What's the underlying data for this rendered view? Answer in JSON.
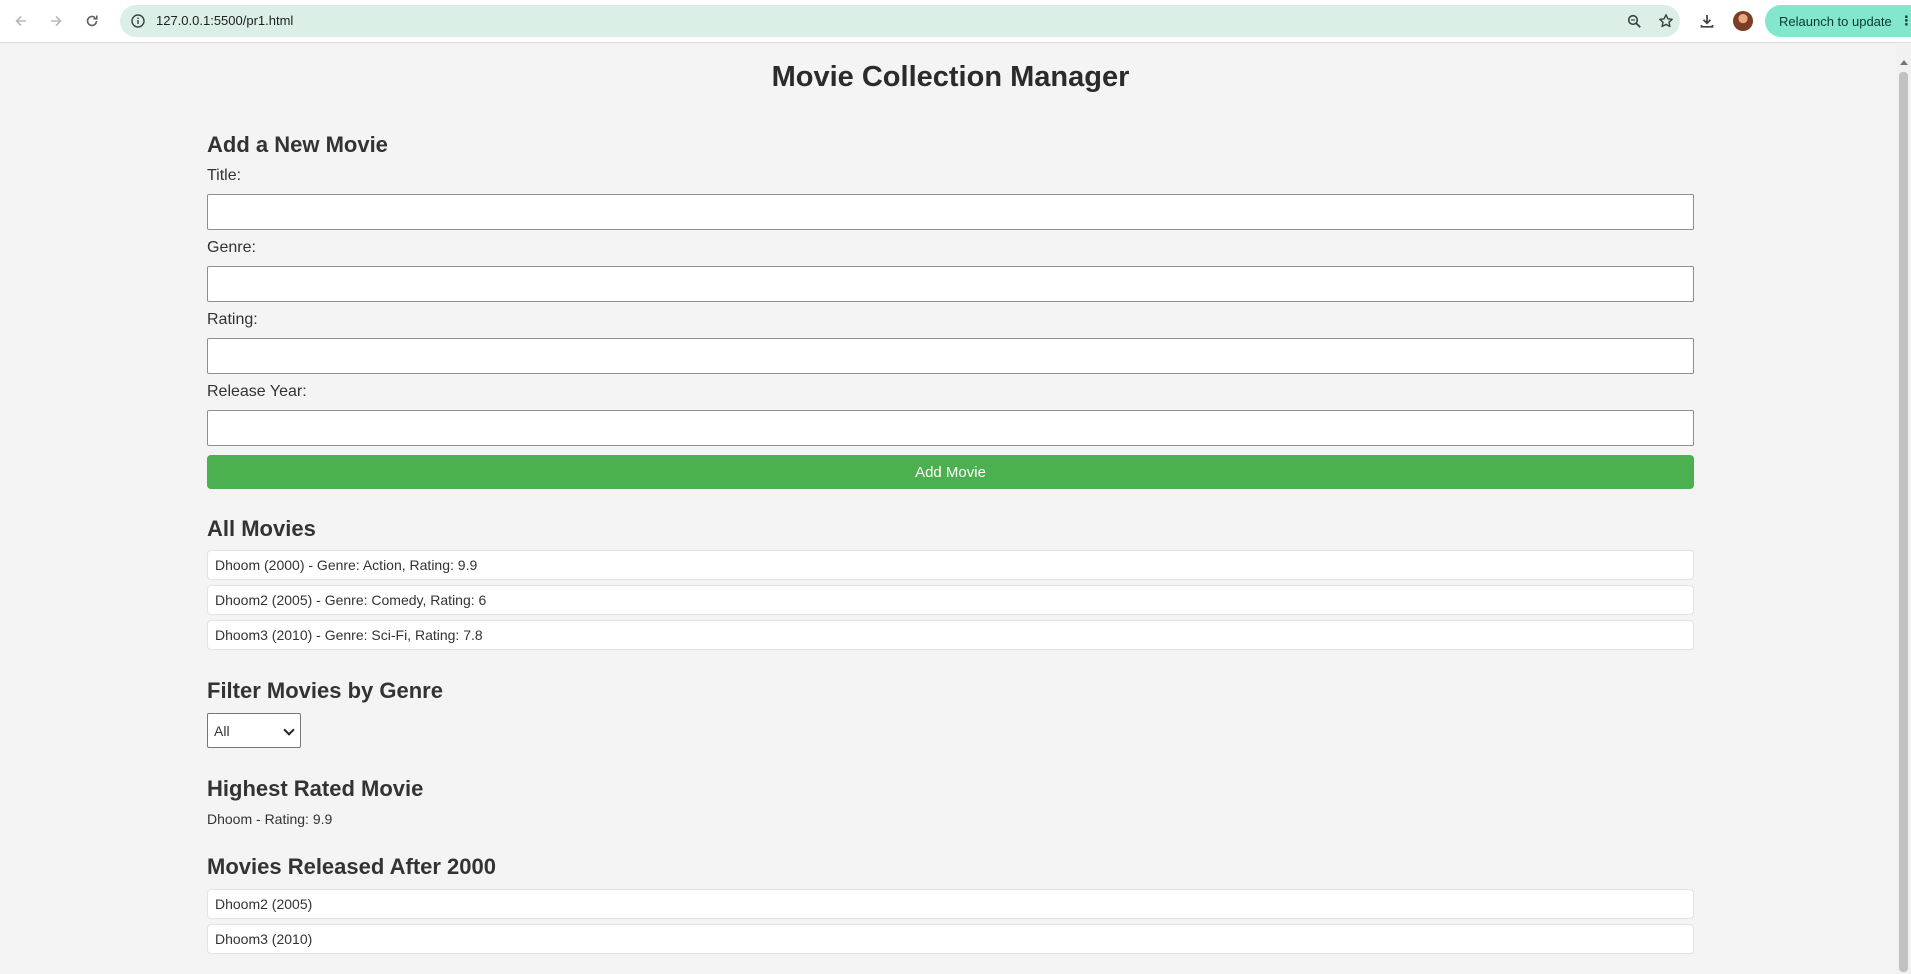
{
  "browser": {
    "url": "127.0.0.1:5500/pr1.html",
    "relaunch_label": "Relaunch to update",
    "icons": [
      "back-icon",
      "forward-icon",
      "reload-icon",
      "site-info-icon",
      "zoom-icon",
      "bookmark-star-icon",
      "download-icon",
      "profile-avatar",
      "menu-kebab-icon"
    ]
  },
  "page": {
    "title": "Movie Collection Manager",
    "add_section": {
      "heading": "Add a New Movie",
      "fields": [
        {
          "label": "Title:",
          "value": ""
        },
        {
          "label": "Genre:",
          "value": ""
        },
        {
          "label": "Rating:",
          "value": ""
        },
        {
          "label": "Release Year:",
          "value": ""
        }
      ],
      "button_label": "Add Movie"
    },
    "all_movies": {
      "heading": "All Movies",
      "items": [
        "Dhoom (2000) - Genre: Action, Rating: 9.9",
        "Dhoom2 (2005) - Genre: Comedy, Rating: 6",
        "Dhoom3 (2010) - Genre: Sci-Fi, Rating: 7.8"
      ]
    },
    "filter": {
      "heading": "Filter Movies by Genre",
      "selected": "All"
    },
    "highest_rated": {
      "heading": "Highest Rated Movie",
      "text": "Dhoom - Rating: 9.9"
    },
    "after_2000": {
      "heading": "Movies Released After 2000",
      "items": [
        "Dhoom2 (2005)",
        "Dhoom3 (2010)"
      ]
    }
  },
  "colors": {
    "add_button": "#4caf50",
    "page_background": "#f4f4f4",
    "omnibox": "#dcefe6",
    "relaunch": "#82e7cd"
  }
}
